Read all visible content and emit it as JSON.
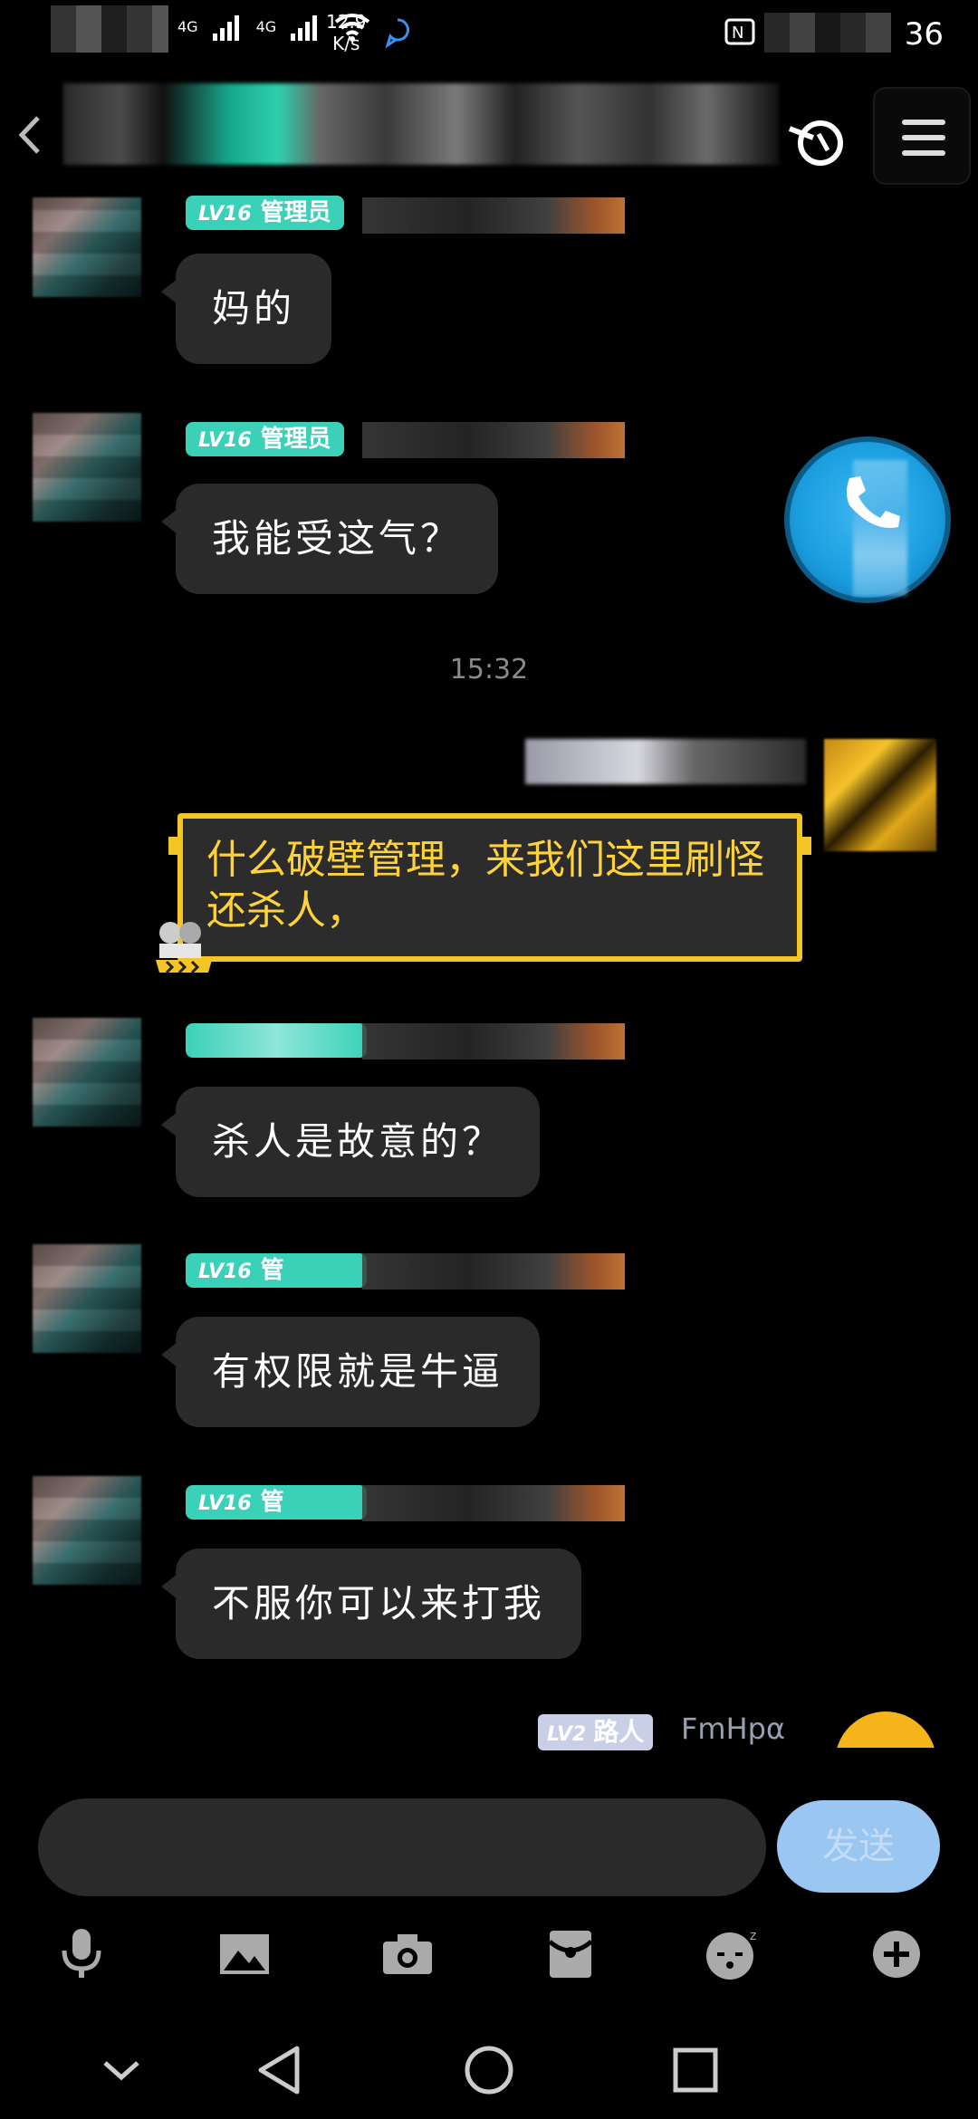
{
  "status_bar": {
    "network_1": "4G",
    "network_2": "4G",
    "speed_value": "12.9",
    "speed_unit": "K/s",
    "time_fragment": "36"
  },
  "header": {
    "back_icon": "chevron-left-icon",
    "right_icon": "hook-icon",
    "menu_icon": "hamburger-menu-icon"
  },
  "messages": [
    {
      "badge_level": "LV16",
      "badge_title": "管理员",
      "text": "妈的"
    },
    {
      "badge_level": "LV16",
      "badge_title": "管理员",
      "text": "我能受这气？"
    },
    {
      "badge_level": "",
      "badge_title": "",
      "text": "杀人是故意的？"
    },
    {
      "badge_level": "LV16",
      "badge_title": "管",
      "text": "有权限就是牛逼"
    },
    {
      "badge_level": "LV16",
      "badge_title": "管",
      "text": "不服你可以来打我"
    }
  ],
  "timestamp": "15:32",
  "outgoing": {
    "text": "什么破壁管理，来我们这里刷怪还杀人，"
  },
  "next_sender": {
    "badge_level": "LV2",
    "badge_title": "路人",
    "name": "FmHpα"
  },
  "call_button": {
    "icon": "phone-icon"
  },
  "composer": {
    "input_value": "",
    "send_label": "发送"
  },
  "toolbar": [
    "microphone-icon",
    "image-icon",
    "camera-icon",
    "red-packet-icon",
    "sleepy-emoji-icon",
    "plus-icon"
  ],
  "nav_bar": [
    "collapse-icon",
    "back-icon",
    "home-icon",
    "recents-icon"
  ],
  "colors": {
    "background": "#000000",
    "bubble": "#2a2a2a",
    "admin_badge": "#3bd1b8",
    "special_border": "#f5c526",
    "special_text": "#ffd23a",
    "send_button": "#9ac7f2",
    "call_button": "#1a9ee0"
  }
}
